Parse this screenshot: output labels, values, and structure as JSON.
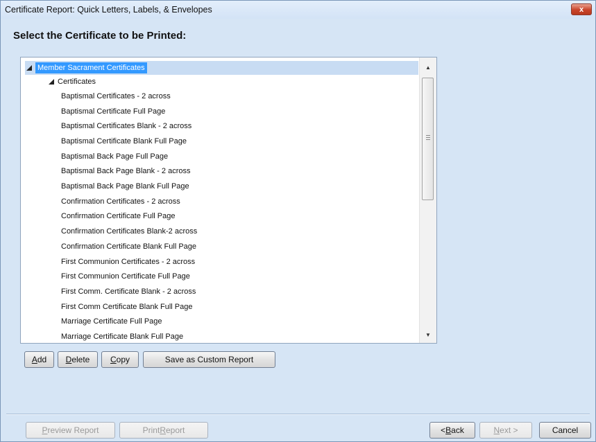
{
  "window": {
    "title": "Certificate Report:  Quick Letters, Labels, & Envelopes",
    "close_label": "x"
  },
  "heading": "Select the Certificate to be Printed:",
  "tree": {
    "root": "Member Sacrament Certificates",
    "group": "Certificates",
    "items": [
      "Baptismal Certificates - 2 across",
      "Baptismal Certificate Full Page",
      "Baptismal Certificates Blank - 2 across",
      "Baptismal Certificate Blank Full Page",
      "Baptismal Back Page Full Page",
      "Baptismal Back Page Blank - 2 across",
      "Baptismal Back Page Blank Full Page",
      "Confirmation Certificates - 2 across",
      "Confirmation Certificate Full Page",
      "Confirmation Certificates Blank-2 across",
      "Confirmation Certificate Blank Full Page",
      "First Communion Certificates - 2 across",
      "First Communion Certificate Full Page",
      "First Comm. Certificate Blank - 2 across",
      "First Comm Certificate Blank Full Page",
      "Marriage Certificate Full Page",
      "Marriage Certificate Blank Full Page"
    ]
  },
  "actions": {
    "add": {
      "first": "A",
      "rest": "dd"
    },
    "delete": {
      "first": "D",
      "rest": "elete"
    },
    "copy": {
      "first": "C",
      "rest": "opy"
    },
    "save_custom": "Save as Custom Report"
  },
  "footer": {
    "preview": {
      "first": "P",
      "rest": "review Report"
    },
    "print": {
      "before": "Print ",
      "first": "R",
      "rest": "eport"
    },
    "back": {
      "before": "< ",
      "first": "B",
      "rest": "ack"
    },
    "next": {
      "first": "N",
      "rest": "ext >"
    },
    "cancel": "Cancel"
  },
  "colors": {
    "selection": "#3399ff",
    "window_bg": "#d6e5f5",
    "close_button": "#c9452a"
  }
}
